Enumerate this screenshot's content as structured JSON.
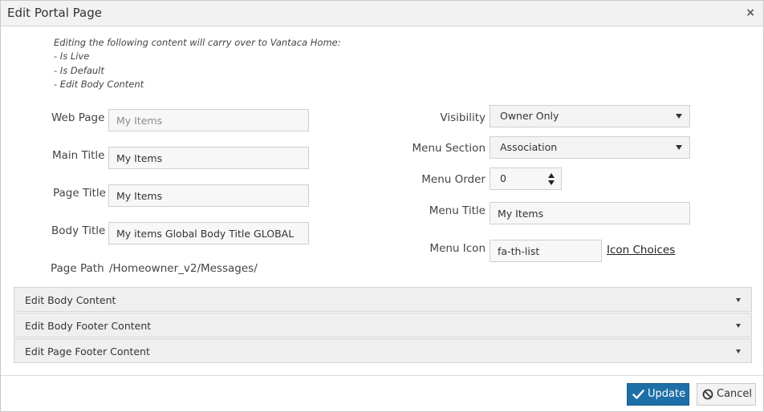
{
  "window": {
    "title": "Edit Portal Page",
    "close_glyph": "×"
  },
  "notice": {
    "heading": "Editing the following content will carry over to Vantaca Home:",
    "items": [
      "- Is Live",
      "- Is Default",
      "- Edit Body Content"
    ]
  },
  "form": {
    "web_page": {
      "label": "Web Page",
      "value": "My Items"
    },
    "main_title": {
      "label": "Main Title",
      "value": "My Items"
    },
    "page_title": {
      "label": "Page Title",
      "value": "My Items"
    },
    "body_title": {
      "label": "Body Title",
      "value": "My items Global Body Title GLOBAL"
    },
    "page_path": {
      "label": "Page Path",
      "value": "/Homeowner_v2/Messages/"
    },
    "visibility": {
      "label": "Visibility",
      "value": "Owner Only"
    },
    "menu_section": {
      "label": "Menu Section",
      "value": "Association"
    },
    "menu_order": {
      "label": "Menu Order",
      "value": "0"
    },
    "menu_title": {
      "label": "Menu Title",
      "value": "My Items"
    },
    "menu_icon": {
      "label": "Menu Icon",
      "value": "fa-th-list",
      "link": "Icon Choices"
    }
  },
  "sections": [
    {
      "label": "Edit Body Content"
    },
    {
      "label": "Edit Body Footer Content"
    },
    {
      "label": "Edit Page Footer Content"
    }
  ],
  "buttons": {
    "update": "Update",
    "cancel": "Cancel"
  },
  "colors": {
    "primary": "#1e6fa8",
    "panel": "#efefef",
    "titlebar": "#f2f2f2"
  },
  "icons": {
    "update": "check-icon",
    "cancel": "ban-icon",
    "close": "close-icon"
  }
}
